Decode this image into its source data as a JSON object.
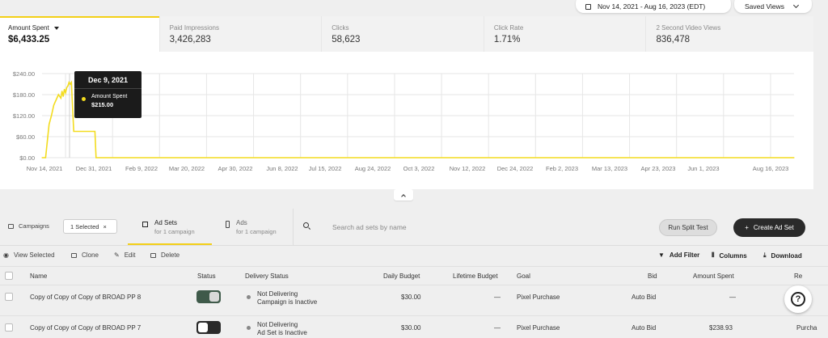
{
  "topbar": {
    "date_range": "Nov 14, 2021 - Aug 16, 2023 (EDT)",
    "saved_views": "Saved Views"
  },
  "metrics": [
    {
      "label": "Amount Spent",
      "value": "$6,433.25"
    },
    {
      "label": "Paid Impressions",
      "value": "3,426,283"
    },
    {
      "label": "Clicks",
      "value": "58,623"
    },
    {
      "label": "Click Rate",
      "value": "1.71%"
    },
    {
      "label": "2 Second Video Views",
      "value": "836,478"
    }
  ],
  "chart_data": {
    "type": "line",
    "y_ticks": [
      "$240.00",
      "$180.00",
      "$120.00",
      "$60.00",
      "$0.00"
    ],
    "x_ticks": [
      "Nov 14, 2021",
      "Dec 31, 2021",
      "Feb 9, 2022",
      "Mar 20, 2022",
      "Apr 30, 2022",
      "Jun 8, 2022",
      "Jul 15, 2022",
      "Aug 24, 2022",
      "Oct 3, 2022",
      "Nov 12, 2022",
      "Dec 24, 2022",
      "Feb 2, 2023",
      "Mar 13, 2023",
      "Apr 23, 2023",
      "Jun 1, 2023",
      "Aug 16, 2023"
    ],
    "ylim": [
      0,
      240
    ],
    "grid": true,
    "color": "#f3dc1f",
    "series": [
      {
        "points": [
          [
            "2021-11-14",
            0
          ],
          [
            "2021-11-17",
            0
          ],
          [
            "2021-11-20",
            95
          ],
          [
            "2021-11-22",
            120
          ],
          [
            "2021-11-24",
            150
          ],
          [
            "2021-11-26",
            165
          ],
          [
            "2021-11-28",
            180
          ],
          [
            "2021-11-30",
            170
          ],
          [
            "2021-12-01",
            190
          ],
          [
            "2021-12-02",
            175
          ],
          [
            "2021-12-03",
            195
          ],
          [
            "2021-12-04",
            185
          ],
          [
            "2021-12-05",
            200
          ],
          [
            "2021-12-06",
            205
          ],
          [
            "2021-12-07",
            215
          ],
          [
            "2021-12-08",
            210
          ],
          [
            "2021-12-09",
            215
          ],
          [
            "2021-12-10",
            140
          ],
          [
            "2021-12-11",
            75
          ],
          [
            "2021-12-28",
            75
          ],
          [
            "2021-12-29",
            75
          ],
          [
            "2021-12-30",
            0
          ],
          [
            "2023-08-16",
            0
          ]
        ]
      }
    ],
    "tooltip": {
      "date": "Dec 9, 2021",
      "series": "Amount Spent",
      "value": "$215.00"
    }
  },
  "tabs": {
    "campaigns": "Campaigns",
    "selected_chip": "1 Selected",
    "adsets_title": "Ad Sets",
    "adsets_sub": "for 1 campaign",
    "ads_title": "Ads",
    "ads_sub": "for 1 campaign",
    "search_placeholder": "Search ad sets by name",
    "split_test": "Run Split Test",
    "create": "Create Ad Set"
  },
  "toolbar": {
    "view_selected": "View Selected",
    "clone": "Clone",
    "edit": "Edit",
    "delete": "Delete",
    "add_filter": "Add Filter",
    "columns": "Columns",
    "download": "Download"
  },
  "table": {
    "headers": [
      "Name",
      "Status",
      "Delivery Status",
      "Daily Budget",
      "Lifetime Budget",
      "Goal",
      "Bid",
      "Amount Spent",
      "Re"
    ],
    "rows": [
      {
        "name": "Copy of Copy of Copy of BROAD PP 8",
        "status": "on",
        "delivery1": "Not Delivering",
        "delivery2": "Campaign is Inactive",
        "daily": "$30.00",
        "lifetime": "—",
        "goal": "Pixel Purchase",
        "bid": "Auto Bid",
        "spent": "—",
        "re": ""
      },
      {
        "name": "Copy of Copy of Copy of BROAD PP 7",
        "status": "off",
        "delivery1": "Not Delivering",
        "delivery2": "Ad Set is Inactive",
        "daily": "$30.00",
        "lifetime": "—",
        "goal": "Pixel Purchase",
        "bid": "Auto Bid",
        "spent": "$238.93",
        "re": "Purcha"
      }
    ]
  }
}
